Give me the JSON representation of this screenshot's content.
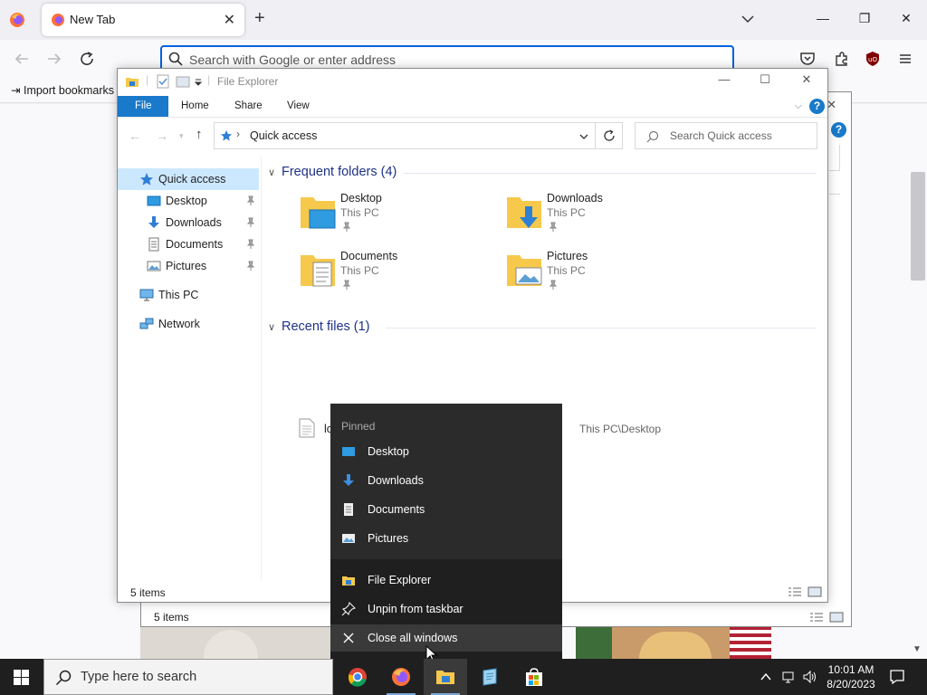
{
  "firefox": {
    "tab_title": "New Tab",
    "url_placeholder": "Search with Google or enter address",
    "import_bookmarks": "Import bookmarks"
  },
  "background_explorer": {
    "status": "5 items"
  },
  "explorer": {
    "title": "File Explorer",
    "ribbon_tabs": [
      "File",
      "Home",
      "Share",
      "View"
    ],
    "address_crumb": "Quick access",
    "search_placeholder": "Search Quick access",
    "nav": [
      {
        "label": "Quick access",
        "icon": "star-icon",
        "selected": true
      },
      {
        "label": "Desktop",
        "icon": "desktop-icon",
        "pinned": true
      },
      {
        "label": "Downloads",
        "icon": "downloads-icon",
        "pinned": true
      },
      {
        "label": "Documents",
        "icon": "documents-icon",
        "pinned": true
      },
      {
        "label": "Pictures",
        "icon": "pictures-icon",
        "pinned": true
      },
      {
        "label": "This PC",
        "icon": "computer-icon"
      },
      {
        "label": "Network",
        "icon": "network-icon"
      }
    ],
    "frequent_header": "Frequent folders (4)",
    "frequent": [
      {
        "name": "Desktop",
        "location": "This PC"
      },
      {
        "name": "Downloads",
        "location": "This PC"
      },
      {
        "name": "Documents",
        "location": "This PC"
      },
      {
        "name": "Pictures",
        "location": "This PC"
      }
    ],
    "recent_header": "Recent files (1)",
    "recent": [
      {
        "name": "lol",
        "path": "This PC\\Desktop"
      }
    ],
    "status": "5 items"
  },
  "jumplist": {
    "pinned_header": "Pinned",
    "pinned": [
      "Desktop",
      "Downloads",
      "Documents",
      "Pictures"
    ],
    "actions": [
      "File Explorer",
      "Unpin from taskbar",
      "Close all windows"
    ]
  },
  "taskbar": {
    "search_placeholder": "Type here to search",
    "time": "10:01 AM",
    "date": "8/20/2023"
  },
  "colors": {
    "accent": "#1979ca",
    "firefox_focus": "#0061e0",
    "folder": "#f6c94d",
    "taskbar": "#1f1f1f"
  }
}
